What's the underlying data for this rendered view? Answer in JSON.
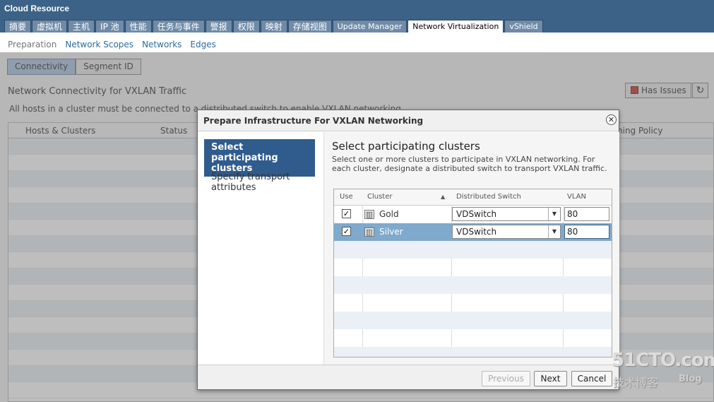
{
  "header": {
    "title": "Cloud Resource",
    "tabs": [
      {
        "label": "摘要"
      },
      {
        "label": "虚拟机"
      },
      {
        "label": "主机"
      },
      {
        "label": "IP 池"
      },
      {
        "label": "性能"
      },
      {
        "label": "任务与事件"
      },
      {
        "label": "警报"
      },
      {
        "label": "权限"
      },
      {
        "label": "映射"
      },
      {
        "label": "存储视图"
      },
      {
        "label": "Update Manager"
      },
      {
        "label": "Network Virtualization"
      },
      {
        "label": "vShield"
      }
    ],
    "active_tab": "Network Virtualization"
  },
  "subnav": {
    "items": [
      {
        "label": "Preparation"
      },
      {
        "label": "Network Scopes"
      },
      {
        "label": "Networks"
      },
      {
        "label": "Edges"
      }
    ]
  },
  "background": {
    "segments": [
      {
        "label": "Connectivity"
      },
      {
        "label": "Segment ID"
      }
    ],
    "section_title": "Network Connectivity for VXLAN Traffic",
    "description": "All hosts in a cluster must be connected to a distributed switch to enable VXLAN networking.",
    "has_issues_label": "Has Issues",
    "refresh_icon": "↻",
    "table_headers": [
      "Hosts & Clusters",
      "Status",
      "ning Policy"
    ]
  },
  "dialog": {
    "title": "Prepare Infrastructure For VXLAN Networking",
    "close_icon": "✕",
    "steps": [
      {
        "label": "Select participating clusters"
      },
      {
        "label": "Specify transport attributes"
      }
    ],
    "panel": {
      "title": "Select participating clusters",
      "description": "Select one or more clusters to participate in VXLAN networking. For each cluster, designate a distributed switch to transport VXLAN traffic."
    },
    "grid": {
      "headers": {
        "use": "Use",
        "cluster": "Cluster",
        "sort_icon": "▲",
        "switch": "Distributed Switch",
        "vlan": "VLAN"
      },
      "rows": [
        {
          "checked": "✓",
          "cluster": "Gold",
          "switch": "VDSwitch",
          "vlan": "80"
        },
        {
          "checked": "✓",
          "cluster": "Silver",
          "switch": "VDSwitch",
          "vlan": "80"
        }
      ],
      "cluster_icon": "▥",
      "dropdown_arrow": "▼"
    },
    "footer": {
      "previous": "Previous",
      "next": "Next",
      "cancel": "Cancel"
    }
  },
  "watermark": {
    "top": "51CTO.com",
    "bottom": "技术博客",
    "blog": "Blog"
  }
}
